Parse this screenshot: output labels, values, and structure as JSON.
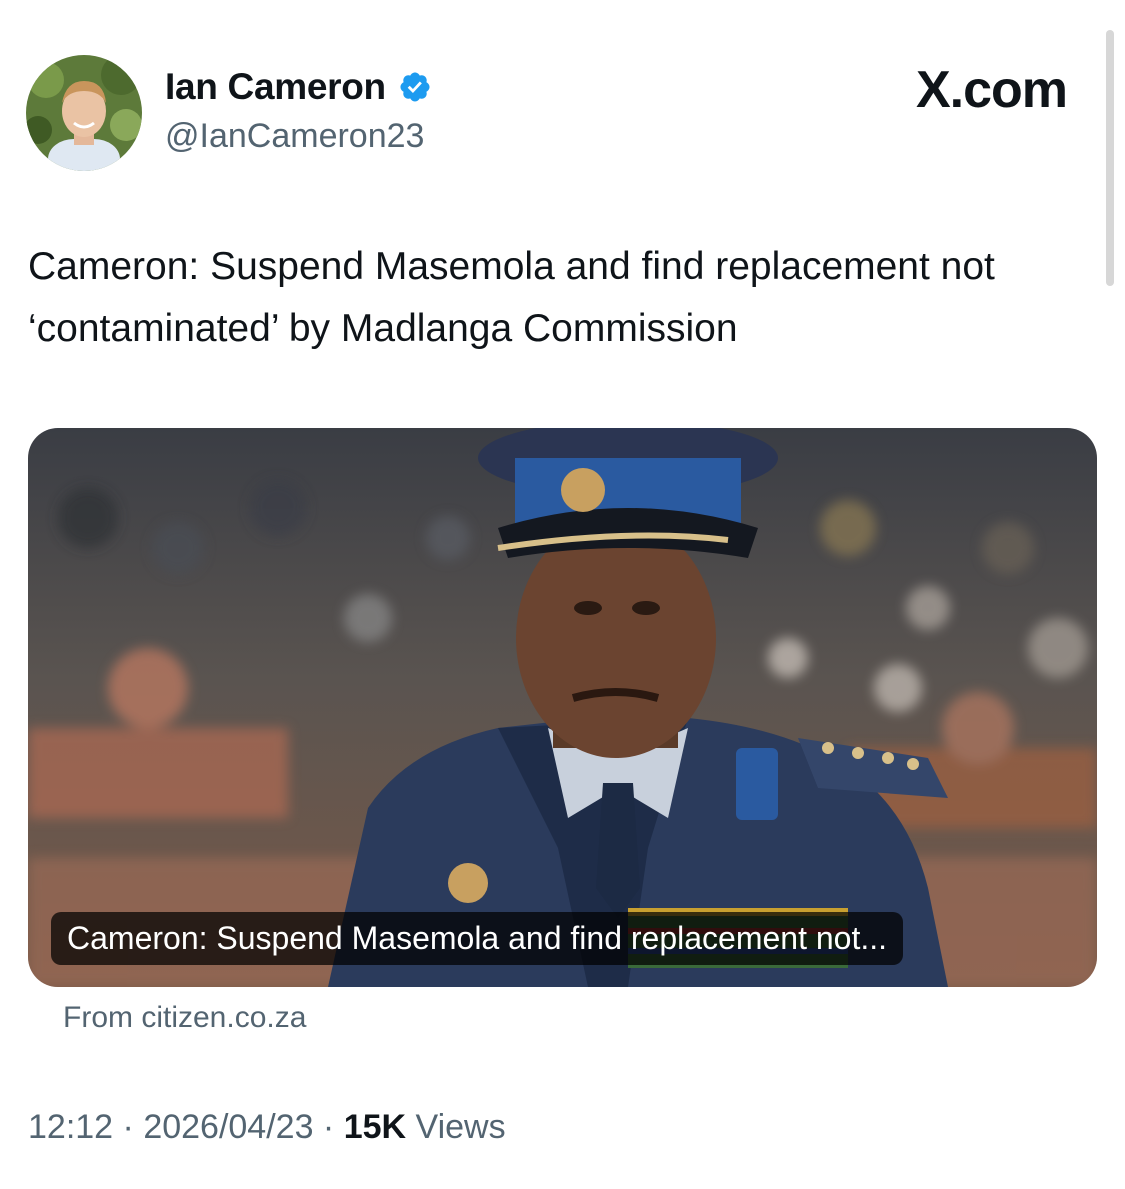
{
  "author": {
    "display_name": "Ian Cameron",
    "handle": "@IanCameron23",
    "verified_icon": "verified-badge-icon"
  },
  "brand": {
    "label": "X.com"
  },
  "tweet": {
    "text": "Cameron: Suspend Masemola and find replacement not ‘contaminated’ by Madlanga Commission"
  },
  "card": {
    "caption": "Cameron: Suspend Masemola and find replacement not...",
    "source": "From citizen.co.za",
    "image_subject": "police-general-portrait"
  },
  "meta": {
    "time": "12:12",
    "separator1": " · ",
    "date": "2026/04/23",
    "separator2": " · ",
    "views_count": "15K",
    "views_label": " Views"
  },
  "colors": {
    "text_primary": "#0f1419",
    "text_secondary": "#536471",
    "verified_blue": "#1d9bf0"
  }
}
